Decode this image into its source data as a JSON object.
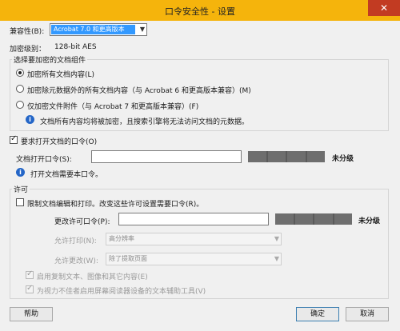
{
  "window": {
    "title": "口令安全性 - 设置",
    "close_glyph": "✕"
  },
  "compatibility": {
    "label": "兼容性(B):",
    "selected": "Acrobat 7.0 和更高版本"
  },
  "encryption_level": {
    "label": "加密级别：",
    "value": "128-bit AES"
  },
  "components": {
    "title": "选择要加密的文档组件",
    "options": [
      {
        "label": "加密所有文档内容(L)",
        "selected": true
      },
      {
        "label": "加密除元数据外的所有文档内容（与 Acrobat 6 和更高版本兼容）(M)",
        "selected": false
      },
      {
        "label": "仅加密文件附件（与 Acrobat 7 和更高版本兼容）(F)",
        "selected": false
      }
    ],
    "info": "文档所有内容均将被加密，且搜索引擎将无法访问文档的元数据。"
  },
  "open_password": {
    "require_label": "要求打开文档的口令(O)",
    "require_checked": true,
    "field_label": "文档打开口令(S):",
    "field_value": "",
    "strength": "未分级",
    "info": "打开文档需要本口令。"
  },
  "permissions": {
    "title": "许可",
    "restrict_label": "限制文档编辑和打印。改变这些许可设置需要口令(R)。",
    "restrict_checked": false,
    "change_password_label": "更改许可口令(P):",
    "change_password_value": "",
    "change_password_strength": "未分级",
    "printing": {
      "label": "允许打印(N):",
      "value": "高分辨率"
    },
    "changes": {
      "label": "允许更改(W):",
      "value": "除了提取页面"
    },
    "copy": {
      "label": "启用复制文本、图像和其它内容(E)",
      "checked": true
    },
    "accessibility": {
      "label": "为视力不佳者启用屏幕阅读器设备的文本辅助工具(V)",
      "checked": true
    }
  },
  "buttons": {
    "help": "帮助",
    "ok": "确定",
    "cancel": "取消"
  }
}
